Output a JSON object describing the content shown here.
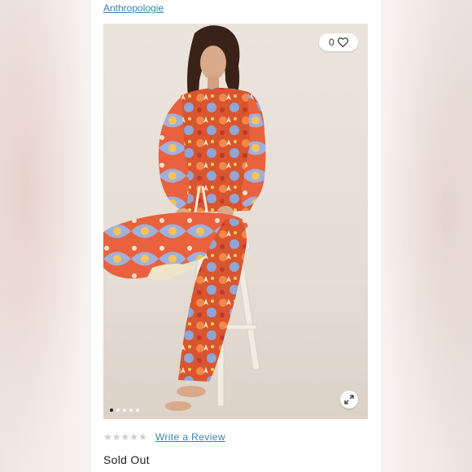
{
  "brand": {
    "label": "Anthropologie"
  },
  "favorite": {
    "count": "0",
    "icon": "heart-icon"
  },
  "gallery": {
    "total_images": 5,
    "active_index": 0,
    "expand_icon": "expand-arrows-icon"
  },
  "rating": {
    "stars_filled": 0,
    "stars_total": 5,
    "star_icon": "star-icon",
    "review_link": "Write a Review"
  },
  "status": {
    "label": "Sold Out"
  },
  "colors": {
    "link": "#3f7fa8",
    "star_empty": "#cfcfcf",
    "text": "#222222"
  }
}
